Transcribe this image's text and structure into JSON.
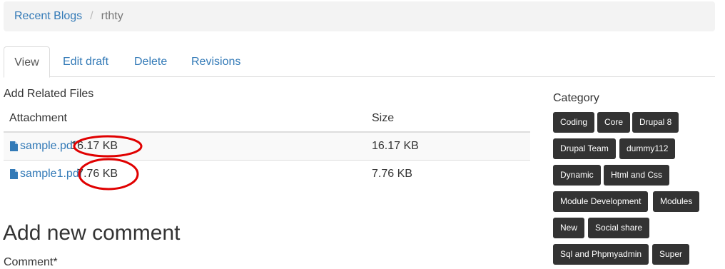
{
  "breadcrumb": {
    "items": [
      {
        "label": "Recent Blogs"
      },
      {
        "label": "rthty"
      }
    ],
    "separator": "/"
  },
  "tabs": [
    {
      "label": "View",
      "active": true
    },
    {
      "label": "Edit draft",
      "active": false
    },
    {
      "label": "Delete",
      "active": false
    },
    {
      "label": "Revisions",
      "active": false
    }
  ],
  "files": {
    "title": "Add Related Files",
    "columns": {
      "attachment": "Attachment",
      "size": "Size"
    },
    "rows": [
      {
        "name": "sample.pdf",
        "inline_size": "16.17 KB",
        "size": "16.17 KB",
        "icon": "file-icon"
      },
      {
        "name": "sample1.pdf",
        "inline_size": "7.76 KB",
        "size": "7.76 KB",
        "icon": "file-icon"
      }
    ]
  },
  "annotation": {
    "color": "#e00000"
  },
  "comment": {
    "title": "Add new comment",
    "label": "Comment*"
  },
  "category": {
    "title": "Category",
    "tags": [
      "Coding",
      "Core",
      "Drupal 8",
      "Drupal Team",
      "dummy112",
      "Dynamic",
      "Html and Css",
      "Module Development",
      "Modules",
      "New",
      "Social share",
      "Sql and Phpmyadmin",
      "Super"
    ]
  }
}
